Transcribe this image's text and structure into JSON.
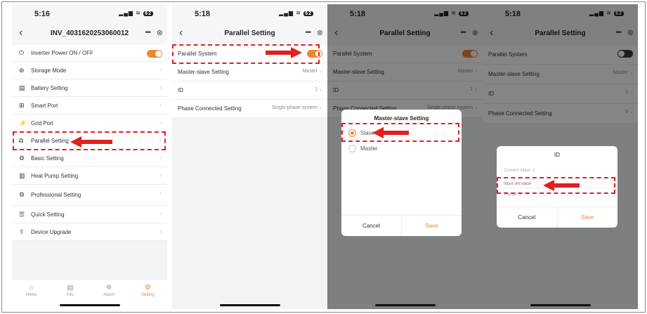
{
  "colors": {
    "accent": "#f0872c",
    "highlight": "#e02020"
  },
  "status_bar": {
    "screen1_time": "5:16",
    "time": "5:18",
    "battery": "62"
  },
  "screen1": {
    "title": "INV_4031620253060012",
    "items": [
      {
        "label": "Inverter Power ON / OFF",
        "icon": "power-icon",
        "glyph": "⏻",
        "toggle": true
      },
      {
        "label": "Storage Mode",
        "icon": "storage-mode-icon",
        "glyph": "⊛"
      },
      {
        "label": "Battery Setting",
        "icon": "battery-icon",
        "glyph": "▤"
      },
      {
        "label": "Smart Port",
        "icon": "smart-port-icon",
        "glyph": "⊞"
      },
      {
        "label": "Grid Port",
        "icon": "grid-port-icon",
        "glyph": "⚡"
      },
      {
        "label": "Parallel Setting",
        "icon": "parallel-icon",
        "glyph": "⧉"
      },
      {
        "label": "Basic Setting",
        "icon": "gear-icon",
        "glyph": "⚙"
      },
      {
        "label": "Heat Pump Setting",
        "icon": "heat-pump-icon",
        "glyph": "▥"
      },
      {
        "label": "Professional Setting",
        "icon": "professional-icon",
        "glyph": "⚙"
      },
      {
        "label": "Quick Setting",
        "icon": "quick-setting-icon",
        "glyph": "☰"
      },
      {
        "label": "Device Upgrade",
        "icon": "upgrade-icon",
        "glyph": "⇧"
      }
    ],
    "tabs": [
      {
        "label": "Home",
        "icon": "home-icon",
        "glyph": "⌂"
      },
      {
        "label": "Info",
        "icon": "info-icon",
        "glyph": "▤"
      },
      {
        "label": "Alarm",
        "icon": "alarm-icon",
        "glyph": "✲"
      },
      {
        "label": "Setting",
        "icon": "setting-icon",
        "glyph": "⚙",
        "active": true
      }
    ]
  },
  "screen2": {
    "title": "Parallel Setting",
    "rows": [
      {
        "label": "Parallel System",
        "toggle": "on"
      },
      {
        "label": "Master-slave Setting",
        "value": "Master"
      },
      {
        "label": "ID",
        "value": "1"
      },
      {
        "label": "Phase Connected Setting",
        "value": "Single-phase system"
      }
    ]
  },
  "screen3": {
    "title": "Parallel Setting",
    "rows": [
      {
        "label": "Parallel System",
        "toggle": "on"
      },
      {
        "label": "Master-slave Setting",
        "value": "Master"
      },
      {
        "label": "ID",
        "value": "1"
      },
      {
        "label": "Phase Connected Setting",
        "value": "Single-phase system"
      }
    ],
    "dialog": {
      "title": "Master-slave Setting",
      "options": [
        {
          "label": "Slave",
          "selected": true
        },
        {
          "label": "Master",
          "selected": false
        }
      ],
      "cancel": "Cancel",
      "save": "Save"
    }
  },
  "screen4": {
    "title": "Parallel Setting",
    "rows": [
      {
        "label": "Parallel System",
        "toggle": "off"
      },
      {
        "label": "Master-slave Setting",
        "value": "Master"
      },
      {
        "label": "ID",
        "value": "1"
      },
      {
        "label": "Phase Connected Setting",
        "value": "9"
      }
    ],
    "dialog": {
      "title": "ID",
      "current_value": "Current Value: 1",
      "placeholder": "Input set value",
      "range": "Range: 1 ~ 6",
      "cancel": "Cancel",
      "save": "Save"
    }
  }
}
